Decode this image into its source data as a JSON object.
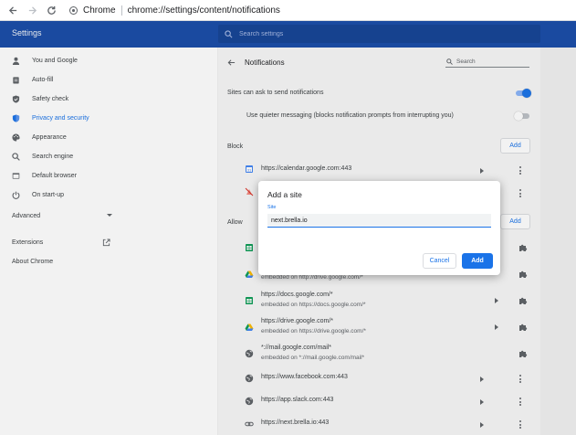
{
  "browser": {
    "chip": "Chrome",
    "url": "chrome://settings/content/notifications"
  },
  "header": {
    "title": "Settings",
    "search_placeholder": "Search settings"
  },
  "sidebar": {
    "items": [
      {
        "label": "You and Google",
        "icon": "person-icon"
      },
      {
        "label": "Auto-fill",
        "icon": "clipboard-icon"
      },
      {
        "label": "Safety check",
        "icon": "shield-check-icon"
      },
      {
        "label": "Privacy and security",
        "icon": "shield-icon",
        "active": true
      },
      {
        "label": "Appearance",
        "icon": "palette-icon"
      },
      {
        "label": "Search engine",
        "icon": "search-icon"
      },
      {
        "label": "Default browser",
        "icon": "browser-icon"
      },
      {
        "label": "On start-up",
        "icon": "power-icon"
      }
    ],
    "advanced": "Advanced",
    "extensions": "Extensions",
    "about": "About Chrome"
  },
  "content": {
    "title": "Notifications",
    "search_placeholder": "Search",
    "ask_label": "Sites can ask to send notifications",
    "ask_toggle": true,
    "quieter_label": "Use quieter messaging (blocks notification prompts from interrupting you)",
    "quieter_toggle": false,
    "block": {
      "title": "Block",
      "add": "Add",
      "sites": [
        {
          "url": "https://calendar.google.com:443",
          "icon": "calendar-icon"
        },
        {
          "url": "",
          "icon": "broken-bell-icon"
        }
      ]
    },
    "allow": {
      "title": "Allow",
      "add": "Add",
      "sites": [
        {
          "url": "",
          "sub": "",
          "icon": "sheets-icon",
          "kind": "extension"
        },
        {
          "url": "",
          "sub": "embedded on http://drive.google.com/*",
          "icon": "drive-icon",
          "kind": "extension"
        },
        {
          "url": "https://docs.google.com/*",
          "sub": "embedded on https://docs.google.com/*",
          "icon": "sheets-icon",
          "kind": "extension"
        },
        {
          "url": "https://drive.google.com/*",
          "sub": "embedded on https://drive.google.com/*",
          "icon": "drive-icon",
          "kind": "extension"
        },
        {
          "url": "*://mail.google.com/mail*",
          "sub": "embedded on *://mail.google.com/mail*",
          "icon": "globe-icon",
          "kind": "extension-noarrow"
        },
        {
          "url": "https://www.facebook.com:443",
          "sub": "",
          "icon": "globe-icon",
          "kind": "menu"
        },
        {
          "url": "https://app.slack.com:443",
          "sub": "",
          "icon": "globe-icon",
          "kind": "menu"
        },
        {
          "url": "https://next.brella.io:443",
          "sub": "",
          "icon": "link-icon",
          "kind": "menu"
        }
      ]
    }
  },
  "dialog": {
    "title": "Add a site",
    "label": "Site",
    "value": "next.brella.io",
    "cancel": "Cancel",
    "add": "Add"
  },
  "colors": {
    "accent": "#1a73e8",
    "header": "#1a4aa0"
  }
}
